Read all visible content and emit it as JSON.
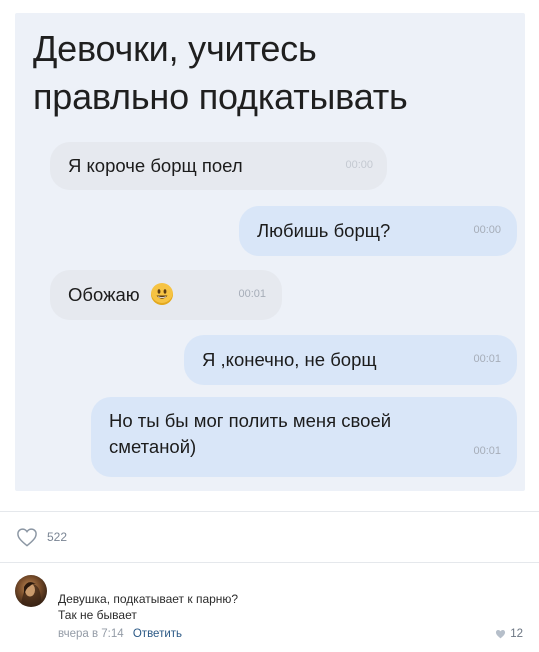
{
  "post": {
    "meme": {
      "title_line1": "Девочки, учитесь",
      "title_line2": "правльно подкатывать",
      "messages": [
        {
          "text": "Я короче борщ поел",
          "time": "00:00",
          "side": "in"
        },
        {
          "text": "Любишь борщ?",
          "time": "00:00",
          "side": "out"
        },
        {
          "text": "Обожаю",
          "time": "00:01",
          "side": "in",
          "emoji": "smiley-icon"
        },
        {
          "text": "Я ,конечно, не борщ",
          "time": "00:01",
          "side": "out"
        },
        {
          "text_line1": "Но ты бы мог полить меня своей",
          "text_line2": "сметаной)",
          "time": "00:01",
          "side": "out"
        }
      ]
    },
    "likes": "522"
  },
  "comment": {
    "line1": "Девушка, подкатывает к парню?",
    "line2": "Так не бывает",
    "time": "вчера в 7:14",
    "reply_label": "Ответить",
    "likes": "12"
  },
  "colors": {
    "meme_background": "#edf1f8",
    "incoming_bubble": "#e6e9ef",
    "outgoing_bubble": "#d9e6f8",
    "link": "#2a5885",
    "meta_gray": "#939ba6"
  }
}
